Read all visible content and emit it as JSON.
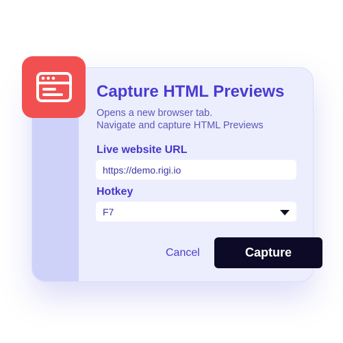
{
  "dialog": {
    "title": "Capture HTML Previews",
    "description_line1": "Opens a new browser tab.",
    "description_line2": "Navigate and capture HTML Previews"
  },
  "url_field": {
    "label": "Live website URL",
    "value": "https://demo.rigi.io"
  },
  "hotkey_field": {
    "label": "Hotkey",
    "selected": "F7"
  },
  "actions": {
    "cancel_label": "Cancel",
    "capture_label": "Capture"
  },
  "icons": {
    "app_icon": "browser-window-icon",
    "dropdown_icon": "caret-down-icon"
  },
  "colors": {
    "accent": "#4a3bd0",
    "icon_tile": "#f25050",
    "dialog_bg": "#eceefe",
    "primary_button": "#0c0a26"
  }
}
